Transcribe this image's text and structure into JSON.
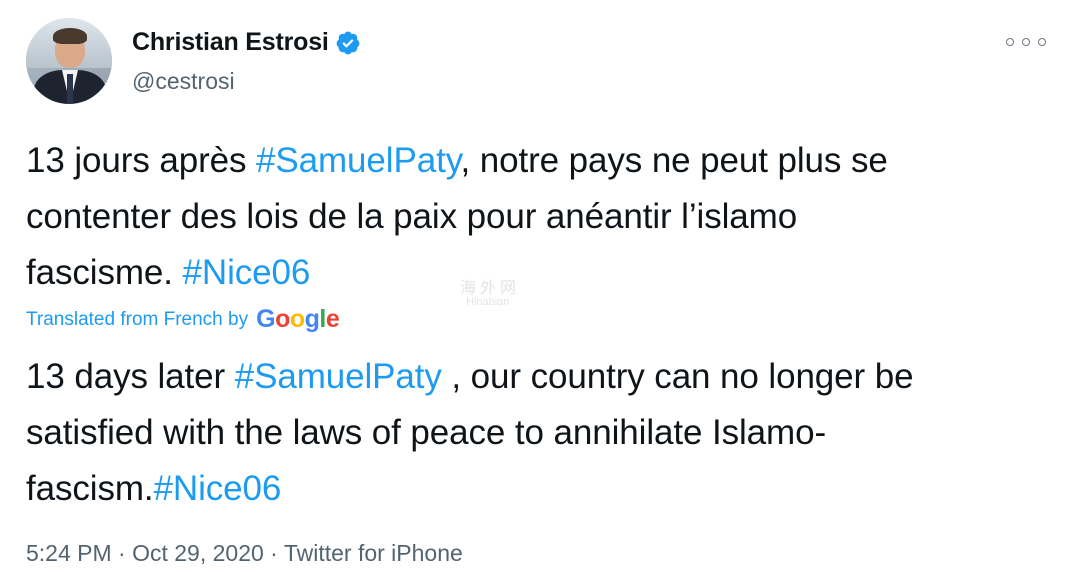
{
  "author": {
    "display_name": "Christian Estrosi",
    "handle": "@cestrosi",
    "verified": true,
    "verified_icon": "verified-badge-icon",
    "avatar_icon": "avatar-photo"
  },
  "more_icon": "more-options-icon",
  "tweet": {
    "original": {
      "p1": "13 jours après ",
      "tag1": "#SamuelPaty",
      "p2": ", notre pays ne peut plus se",
      "p3": "contenter des lois de la paix pour anéantir l’islamo",
      "p4": "fascisme. ",
      "tag2": "#Nice06"
    },
    "translation_label": "Translated from French by",
    "translation_provider": "Google",
    "translated": {
      "p1": "13 days later ",
      "tag1": "#SamuelPaty",
      "p2": " , our country can no longer be",
      "p3": "satisfied with the laws of peace to annihilate Islamo-",
      "p4": "fascism.",
      "tag2": "#Nice06"
    },
    "timestamp": "5:24 PM · Oct 29, 2020 · Twitter for iPhone"
  },
  "watermark": {
    "cn": "海外网",
    "en": "Hinabian"
  },
  "colors": {
    "link": "#1d9bf0",
    "text": "#0f1419",
    "secondary": "#536471",
    "google_blue": "#4285F4",
    "google_red": "#EA4335",
    "google_yellow": "#FBBC05",
    "google_green": "#34A853"
  }
}
